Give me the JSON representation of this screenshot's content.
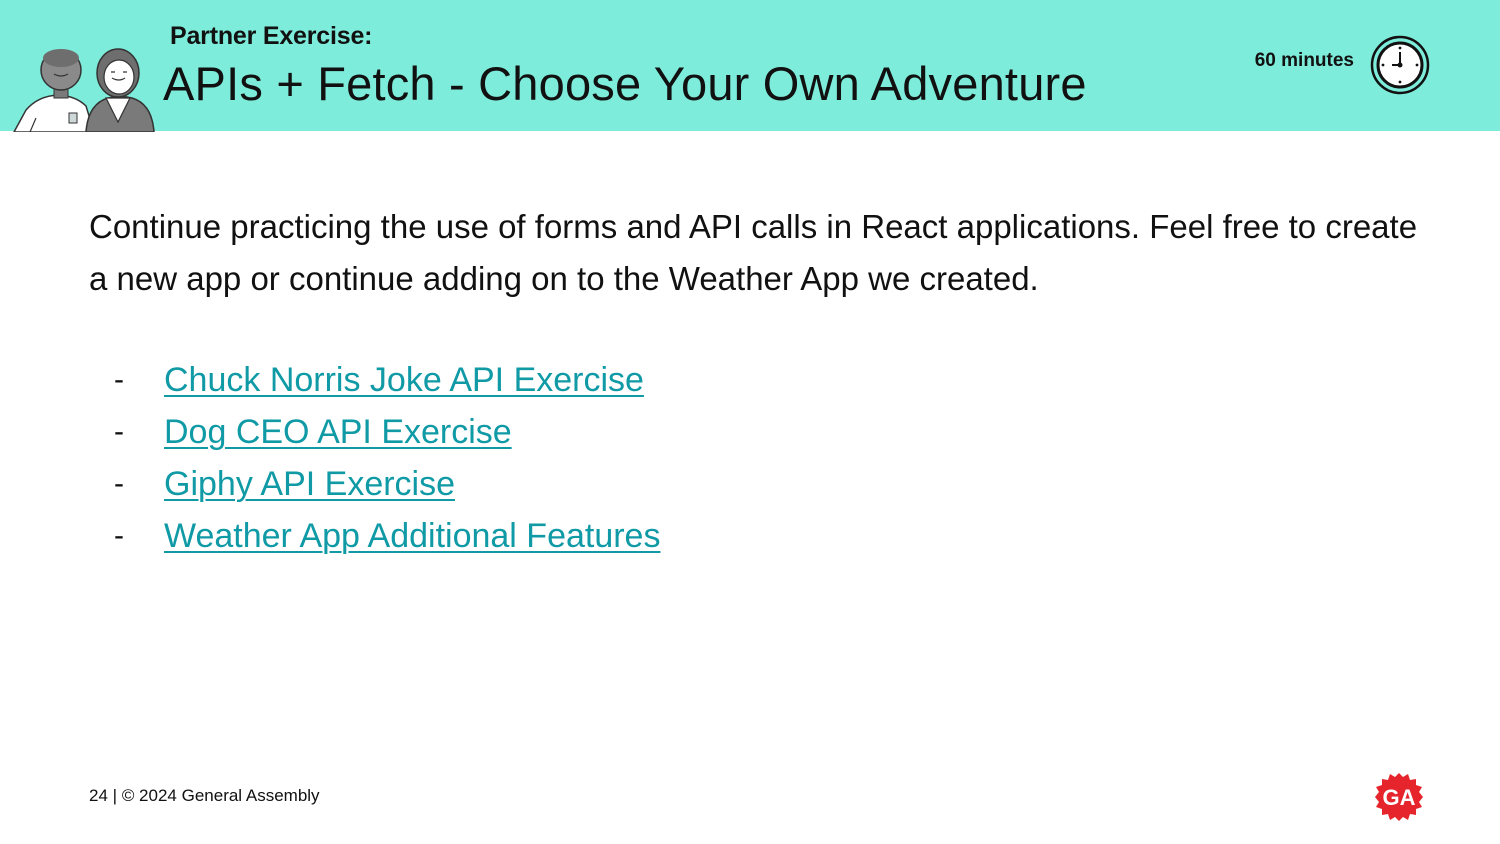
{
  "header": {
    "kicker": "Partner Exercise:",
    "title": "APIs + Fetch - Choose Your Own Adventure",
    "duration": "60 minutes",
    "band_color": "#7eecdb",
    "clock_icon": "clock-icon",
    "illustration": "two-people-illustration"
  },
  "body": {
    "intro": "Continue practicing the use of forms and API calls in React applications. Feel free to create a new app or continue adding on to the Weather App we created.",
    "bullet": "-",
    "link_color": "#0f9aa6",
    "links": [
      {
        "label": "Chuck Norris Joke API Exercise"
      },
      {
        "label": "Dog CEO API Exercise"
      },
      {
        "label": "Giphy API Exercise"
      },
      {
        "label": "Weather App Additional Features"
      }
    ]
  },
  "footer": {
    "page_number": "24",
    "separator": "|",
    "copyright": "© 2024 General Assembly",
    "logo_text": "GA",
    "logo_color": "#e5242c"
  }
}
